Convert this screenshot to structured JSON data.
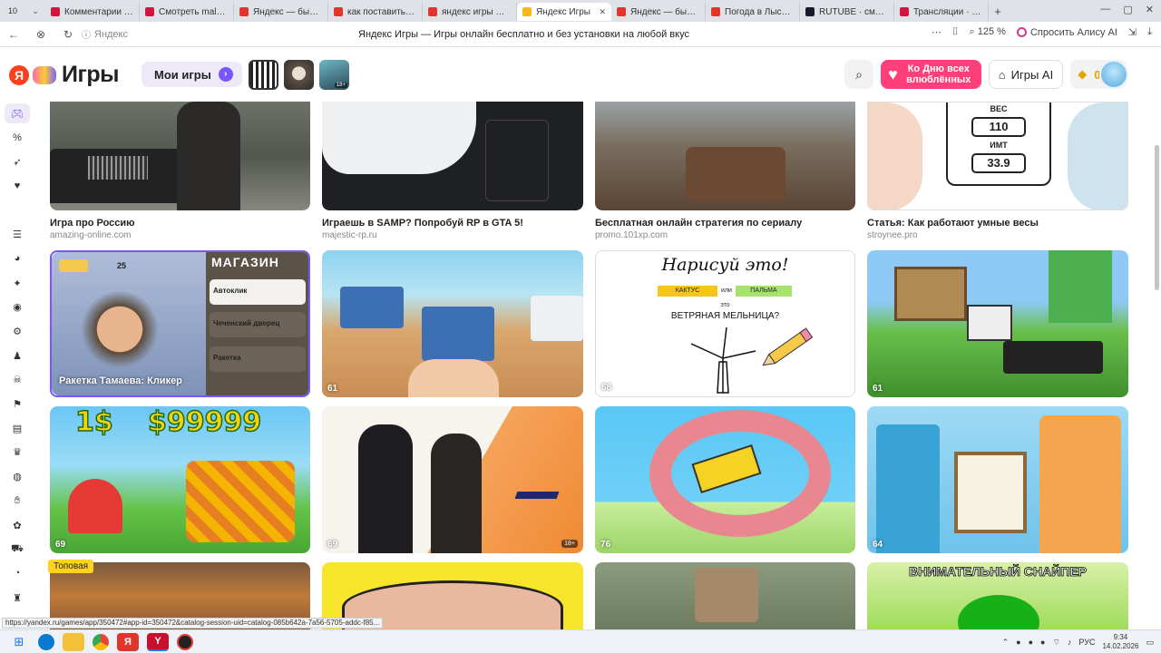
{
  "browser": {
    "tab_count": "10",
    "tabs": [
      {
        "title": "Комментарии · С",
        "color": "#d2153f"
      },
      {
        "title": "Смотреть malaev",
        "color": "#d2153f"
      },
      {
        "title": "Яндекс — быстры",
        "color": "#e0352b"
      },
      {
        "title": "как поставить ско",
        "color": "#e0352b"
      },
      {
        "title": "яндекс игры — Ян",
        "color": "#e0352b"
      },
      {
        "title": "Яндекс Игры",
        "color": "#f6b71a"
      },
      {
        "title": "Яндекс — быстры",
        "color": "#e0352b"
      },
      {
        "title": "Погода в Лысых Г",
        "color": "#e0352b"
      },
      {
        "title": "RUTUBE · смотре",
        "color": "#1a1a2e"
      },
      {
        "title": "Трансляции · Сту",
        "color": "#d2153f"
      }
    ],
    "active_tab": 5,
    "new_tab": "+",
    "url_host": "Яндекс",
    "page_title": "Яндекс Игры — Игры онлайн бесплатно и без установки на любой вкус",
    "zoom": "125 %",
    "alice_label": "Спросить Алису AI"
  },
  "header": {
    "logo_letter": "Я",
    "logo_text": "Игры",
    "my_games": "Мои игры",
    "promo_text": "Ко Дню всех влюблённых",
    "ai_label": "Игры AI",
    "coins": "0"
  },
  "ads": [
    {
      "title": "Игра про Россию",
      "host": "amazing-online.com"
    },
    {
      "title": "Играешь в SAMP? Попробуй RP в GTA 5!",
      "host": "majestic-rp.ru"
    },
    {
      "title": "Бесплатная онлайн стратегия по сериалу",
      "host": "promo.101xp.com"
    },
    {
      "title": "Статья: Как работают умные весы",
      "host": "stroynee.pro"
    }
  ],
  "scale_card": {
    "weight_label": "ВЕС",
    "weight": "110",
    "bmi_label": "ИМТ",
    "bmi": "33.9"
  },
  "games_row1": [
    {
      "title": "Ракетка Тамаева: Кликер",
      "shop": "МАГАЗИН",
      "item1": "Автоклик",
      "item2": "Чеченский дворец",
      "item3": "Ракетка",
      "coins": "25"
    },
    {
      "rating": "61"
    },
    {
      "rating": "68",
      "draw_title": "Нарисуй это!",
      "opt1": "КАКТУС",
      "or": "или",
      "opt2": "ПАЛЬМА",
      "this_is": "это",
      "question": "ВЕТРЯНАЯ МЕЛЬНИЦА?"
    },
    {
      "rating": "61"
    }
  ],
  "games_row2": [
    {
      "rating": "69",
      "left_text": "1$",
      "right_text": "$99999"
    },
    {
      "rating": "69",
      "age": "18+"
    },
    {
      "rating": "76"
    },
    {
      "rating": "64"
    }
  ],
  "row3": {
    "badge": "Топовая",
    "sniper": "ВНИМАТЕЛЬНЫЙ СНАЙПЕР"
  },
  "status_url": "https://yandex.ru/games/app/350472#app-id=350472&catalog-session-uid=catalog-085b642a-7a56-5705-addc-f85...",
  "taskbar": {
    "lang": "РУС",
    "time": "9:34",
    "date": "14.02.2026"
  }
}
